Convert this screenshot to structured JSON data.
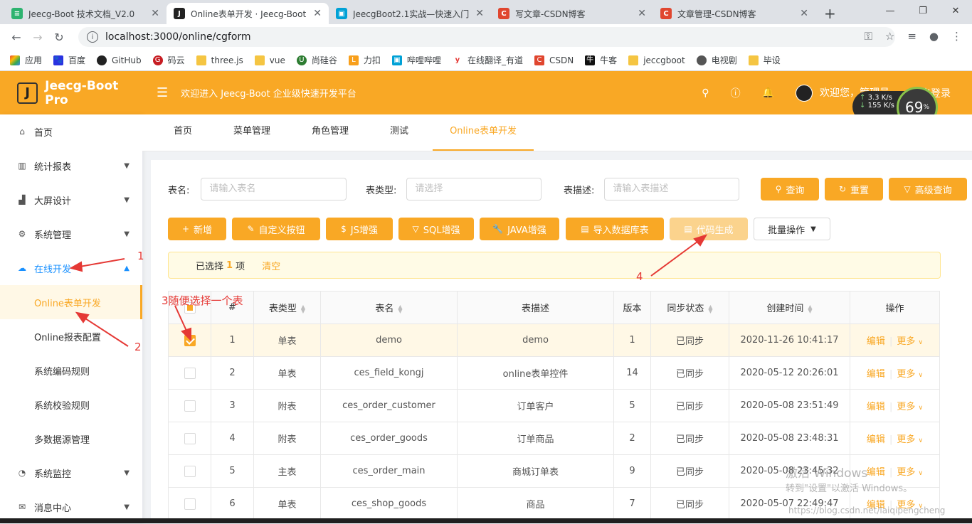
{
  "browser": {
    "tabs": [
      {
        "title": "Jeecg-Boot 技术文档_V2.0",
        "icon": "doc-icon",
        "color": "#2db36f"
      },
      {
        "title": "Online表单开发 · Jeecg-Boot",
        "icon": "jeecg-icon",
        "color": "#222222"
      },
      {
        "title": "JeecgBoot2.1实战—快速入门",
        "icon": "bilibili-icon",
        "color": "#00a1d6"
      },
      {
        "title": "写文章-CSDN博客",
        "icon": "csdn-icon",
        "color": "#e0462f"
      },
      {
        "title": "文章管理-CSDN博客",
        "icon": "csdn-icon",
        "color": "#e0462f"
      }
    ],
    "url": "localhost:3000/online/cgform",
    "bookmarks": [
      {
        "label": "应用",
        "color": "#ea4335"
      },
      {
        "label": "百度",
        "color": "#2932e1"
      },
      {
        "label": "GitHub",
        "color": "#222222"
      },
      {
        "label": "码云",
        "color": "#c71d23"
      },
      {
        "label": "three.js",
        "color": "#f5c542"
      },
      {
        "label": "vue",
        "color": "#f5c542"
      },
      {
        "label": "尚硅谷",
        "color": "#2e7d32"
      },
      {
        "label": "力扣",
        "color": "#f89f1b"
      },
      {
        "label": "哔哩哔哩",
        "color": "#00a1d6"
      },
      {
        "label": "在线翻译_有道",
        "color": "#e53935"
      },
      {
        "label": "CSDN",
        "color": "#e0462f"
      },
      {
        "label": "牛客",
        "color": "#111111"
      },
      {
        "label": "jeccgboot",
        "color": "#f5c542"
      },
      {
        "label": "电视剧",
        "color": "#555555"
      },
      {
        "label": "毕设",
        "color": "#f5c542"
      }
    ]
  },
  "header": {
    "logo_text": "Jeecg-Boot Pro",
    "logo_letter": "J",
    "welcome": "欢迎进入 Jeecg-Boot 企业级快速开发平台",
    "user_text": "欢迎您，管理员",
    "logout": "退出登录",
    "brand_color": "#f9a825"
  },
  "speed_widget": {
    "up": "3.3",
    "down": "155",
    "unit": "K/s",
    "percent": "69",
    "percent_sign": "%"
  },
  "sidebar": {
    "items": [
      {
        "label": "首页",
        "icon": "home-icon"
      },
      {
        "label": "统计报表",
        "icon": "chart-icon"
      },
      {
        "label": "大屏设计",
        "icon": "area-chart-icon"
      },
      {
        "label": "系统管理",
        "icon": "gear-icon"
      },
      {
        "label": "在线开发",
        "icon": "cloud-icon"
      },
      {
        "label": "Online表单开发"
      },
      {
        "label": "Online报表配置"
      },
      {
        "label": "系统编码规则"
      },
      {
        "label": "系统校验规则"
      },
      {
        "label": "多数据源管理"
      },
      {
        "label": "系统监控",
        "icon": "dashboard-icon"
      },
      {
        "label": "消息中心",
        "icon": "message-icon"
      }
    ]
  },
  "page_tabs": [
    "首页",
    "菜单管理",
    "角色管理",
    "测试",
    "Online表单开发"
  ],
  "search": {
    "table_name_label": "表名:",
    "table_name_placeholder": "请输入表名",
    "table_type_label": "表类型:",
    "table_type_placeholder": "请选择",
    "table_desc_label": "表描述:",
    "table_desc_placeholder": "请输入表描述",
    "query": "查询",
    "reset": "重置",
    "advanced": "高级查询"
  },
  "toolbar": {
    "add": "新增",
    "custom_button": "自定义按钮",
    "js": "JS增强",
    "sql": "SQL增强",
    "java": "JAVA增强",
    "import_db": "导入数据库表",
    "codegen": "代码生成",
    "batch": "批量操作"
  },
  "alert": {
    "prefix": "已选择",
    "count": "1",
    "suffix": "项",
    "clear": "清空"
  },
  "table": {
    "headers": [
      "#",
      "表类型",
      "表名",
      "表描述",
      "版本",
      "同步状态",
      "创建时间",
      "操作"
    ],
    "rows": [
      {
        "no": "1",
        "type": "单表",
        "name": "demo",
        "desc": "demo",
        "ver": "1",
        "status": "已同步",
        "time": "2020-11-26 10:41:17",
        "checked": true
      },
      {
        "no": "2",
        "type": "单表",
        "name": "ces_field_kongj",
        "desc": "online表单控件",
        "ver": "14",
        "status": "已同步",
        "time": "2020-05-12 20:26:01",
        "checked": false
      },
      {
        "no": "3",
        "type": "附表",
        "name": "ces_order_customer",
        "desc": "订单客户",
        "ver": "5",
        "status": "已同步",
        "time": "2020-05-08 23:51:49",
        "checked": false
      },
      {
        "no": "4",
        "type": "附表",
        "name": "ces_order_goods",
        "desc": "订单商品",
        "ver": "2",
        "status": "已同步",
        "time": "2020-05-08 23:48:31",
        "checked": false
      },
      {
        "no": "5",
        "type": "主表",
        "name": "ces_order_main",
        "desc": "商城订单表",
        "ver": "9",
        "status": "已同步",
        "time": "2020-05-08 23:45:32",
        "checked": false
      },
      {
        "no": "6",
        "type": "单表",
        "name": "ces_shop_goods",
        "desc": "商品",
        "ver": "7",
        "status": "已同步",
        "time": "2020-05-07 22:49:47",
        "checked": false
      }
    ],
    "edit": "编辑",
    "more": "更多"
  },
  "annotations": {
    "a1": "1",
    "a2": "2",
    "a3": "3随便选择一个表",
    "a4": "4"
  },
  "watermark": {
    "line1": "激活 Windows",
    "line2": "转到\"设置\"以激活 Windows。",
    "url": "https://blog.csdn.net/laiqipengcheng"
  }
}
